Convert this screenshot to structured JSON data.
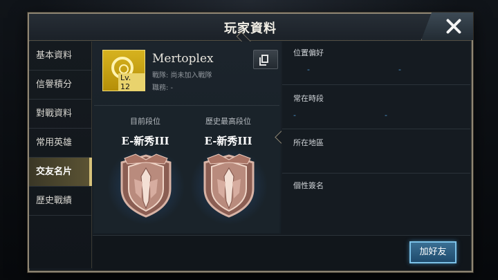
{
  "header": {
    "title": "玩家資料"
  },
  "sidebar": {
    "items": [
      {
        "label": "基本資料"
      },
      {
        "label": "信譽積分"
      },
      {
        "label": "對戰資料"
      },
      {
        "label": "常用英雄"
      },
      {
        "label": "交友名片",
        "active": true
      },
      {
        "label": "歷史戰績"
      }
    ]
  },
  "profile": {
    "name": "Mertoplex",
    "level": "Lv. 12",
    "team": "戰隊: 尚未加入戰隊",
    "role": "職務: -",
    "emblem_color": "#d6b21f"
  },
  "ranks": {
    "current_label": "目前段位",
    "current_value": "E-新秀III",
    "highest_label": "歷史最高段位",
    "highest_value": "E-新秀III"
  },
  "info": {
    "position_pref": {
      "label": "位置偏好",
      "values": [
        "-",
        "-"
      ]
    },
    "active_time": {
      "label": "常在時段",
      "values": [
        "-",
        "-"
      ]
    },
    "region": {
      "label": "所在地區"
    },
    "signature": {
      "label": "個性簽名"
    }
  },
  "actions": {
    "add_friend": "加好友"
  },
  "colors": {
    "accent_gold": "#d7c27a",
    "accent_blue": "#4e9cd6"
  }
}
